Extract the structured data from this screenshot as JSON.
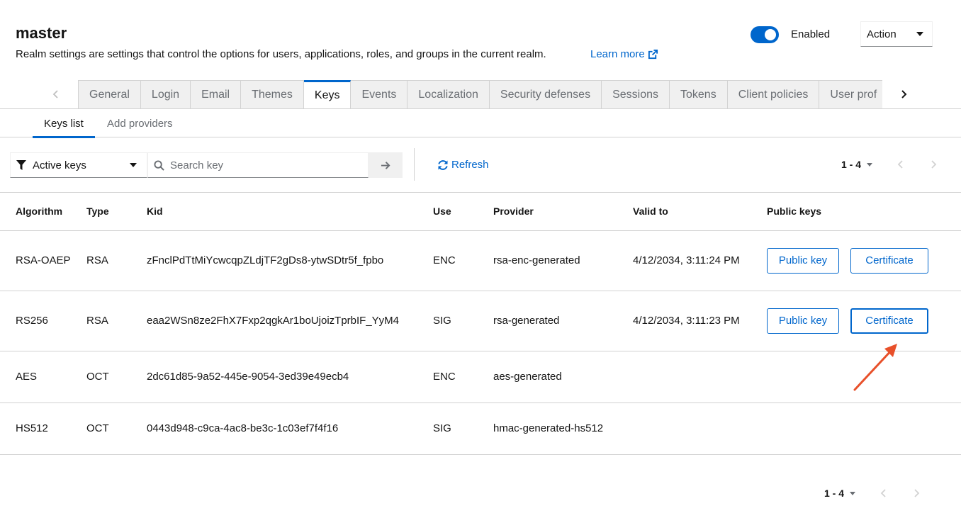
{
  "header": {
    "title": "master",
    "description": "Realm settings are settings that control the options for users, applications, roles, and groups in the current realm.",
    "learn_more": "Learn more",
    "enabled_label": "Enabled",
    "action_label": "Action"
  },
  "tabs": [
    {
      "label": "General"
    },
    {
      "label": "Login"
    },
    {
      "label": "Email"
    },
    {
      "label": "Themes"
    },
    {
      "label": "Keys"
    },
    {
      "label": "Events"
    },
    {
      "label": "Localization"
    },
    {
      "label": "Security defenses"
    },
    {
      "label": "Sessions"
    },
    {
      "label": "Tokens"
    },
    {
      "label": "Client policies"
    },
    {
      "label": "User prof"
    }
  ],
  "subtabs": {
    "keys_list": "Keys list",
    "add_providers": "Add providers"
  },
  "toolbar": {
    "filter_label": "Active keys",
    "search_placeholder": "Search key",
    "refresh_label": "Refresh",
    "pagination": "1 - 4"
  },
  "table": {
    "headers": [
      "Algorithm",
      "Type",
      "Kid",
      "Use",
      "Provider",
      "Valid to",
      "Public keys"
    ],
    "rows": [
      {
        "algorithm": "RSA-OAEP",
        "type": "RSA",
        "kid": "zFnclPdTtMiYcwcqpZLdjTF2gDs8-ytwSDtr5f_fpbo",
        "use": "ENC",
        "provider": "rsa-enc-generated",
        "valid_to": "4/12/2034, 3:11:24 PM",
        "public_key_label": "Public key",
        "certificate_label": "Certificate"
      },
      {
        "algorithm": "RS256",
        "type": "RSA",
        "kid": "eaa2WSn8ze2FhX7Fxp2qgkAr1boUjoizTprbIF_YyM4",
        "use": "SIG",
        "provider": "rsa-generated",
        "valid_to": "4/12/2034, 3:11:23 PM",
        "public_key_label": "Public key",
        "certificate_label": "Certificate"
      },
      {
        "algorithm": "AES",
        "type": "OCT",
        "kid": "2dc61d85-9a52-445e-9054-3ed39e49ecb4",
        "use": "ENC",
        "provider": "aes-generated",
        "valid_to": "",
        "public_key_label": "",
        "certificate_label": ""
      },
      {
        "algorithm": "HS512",
        "type": "OCT",
        "kid": "0443d948-c9ca-4ac8-be3c-1c03ef7f4f16",
        "use": "SIG",
        "provider": "hmac-generated-hs512",
        "valid_to": "",
        "public_key_label": "",
        "certificate_label": ""
      }
    ]
  },
  "footer": {
    "pagination": "1 - 4"
  },
  "colors": {
    "accent": "#0066cc",
    "annotation_arrow": "#e8502a"
  }
}
